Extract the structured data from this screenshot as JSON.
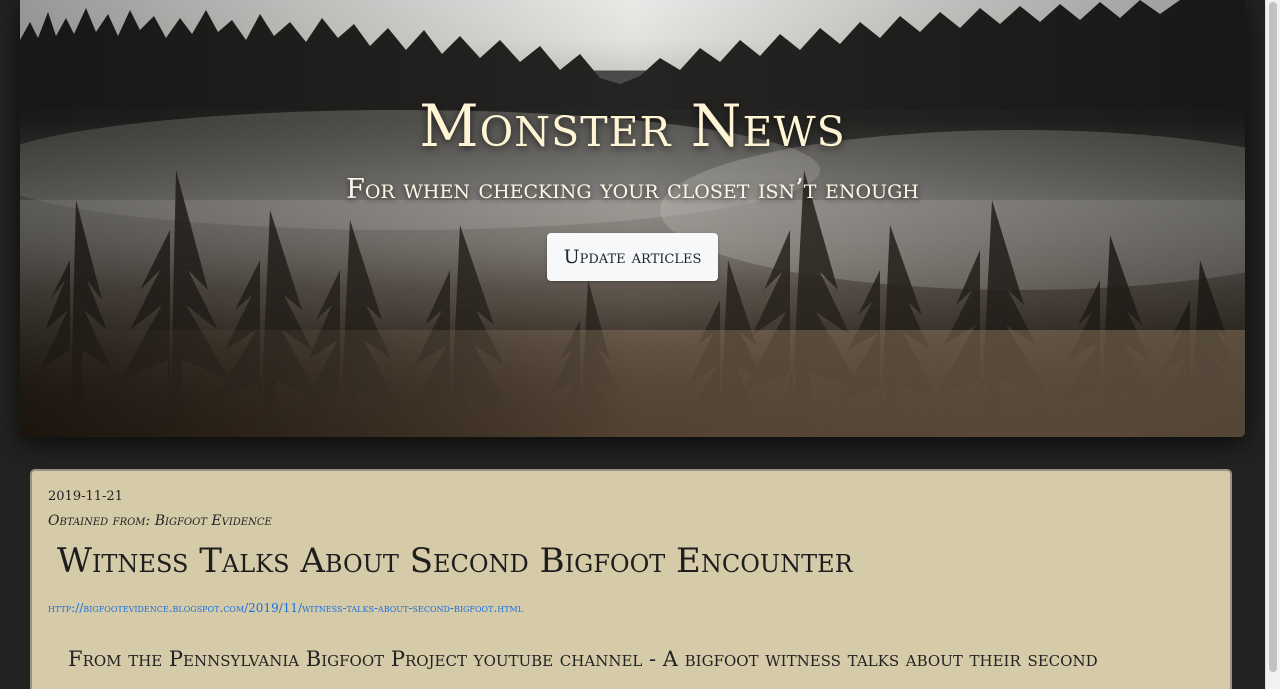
{
  "hero": {
    "title": "Monster News",
    "subtitle": "For when checking your closet isn’t enough",
    "update_button": "Update articles"
  },
  "article": {
    "date": "2019-11-21",
    "source": "Obtained from: Bigfoot Evidence",
    "title": "Witness Talks About Second Bigfoot Encounter",
    "url": "http://bigfootevidence.blogspot.com/2019/11/witness-talks-about-second-bigfoot.html",
    "summary": "From the Pennsylvania Bigfoot Project youtube channel - A bigfoot witness talks about their second"
  },
  "colors": {
    "page_background": "#222220",
    "card_background": "#d6cba8",
    "title_color": "#fff4d6",
    "link_color": "#1b6fe0"
  }
}
